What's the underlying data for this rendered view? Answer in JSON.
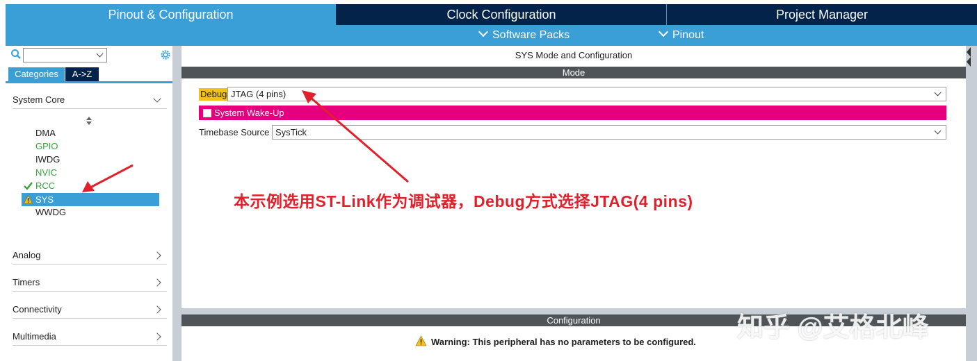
{
  "tabs": [
    {
      "label": "Pinout & Configuration",
      "active": true
    },
    {
      "label": "Clock Configuration",
      "active": false
    },
    {
      "label": "Project Manager",
      "active": false
    }
  ],
  "subtabs": {
    "software_packs": "Software Packs",
    "pinout": "Pinout"
  },
  "left": {
    "search": {
      "value": ""
    },
    "tab_categories": "Categories",
    "tab_az": "A->Z",
    "system_core": "System Core",
    "items": [
      {
        "label": "DMA",
        "status": "none"
      },
      {
        "label": "GPIO",
        "status": "ok"
      },
      {
        "label": "IWDG",
        "status": "none"
      },
      {
        "label": "NVIC",
        "status": "ok"
      },
      {
        "label": "RCC",
        "status": "check"
      },
      {
        "label": "SYS",
        "status": "warning"
      },
      {
        "label": "WWDG",
        "status": "none"
      }
    ],
    "groups": [
      "Analog",
      "Timers",
      "Connectivity",
      "Multimedia"
    ]
  },
  "main": {
    "title": "SYS Mode and Configuration",
    "mode_header": "Mode",
    "debug_label": "Debug",
    "debug_value": "JTAG (4 pins)",
    "wake_label": "System Wake-Up",
    "timebase_label": "Timebase Source",
    "timebase_value": "SysTick",
    "config_header": "Configuration",
    "warning": "Warning: This peripheral has no parameters to be configured."
  },
  "annotation": "本示例选用ST-Link作为调试器，Debug方式选择JTAG(4 pins)",
  "watermark": "知乎 @艾格北峰",
  "colors": {
    "nav_dark": "#03234b",
    "nav_light": "#3a9fd6",
    "wake_pink": "#e6007e",
    "annotation_red": "#e0202a",
    "debug_yellow": "#f2c11a"
  }
}
